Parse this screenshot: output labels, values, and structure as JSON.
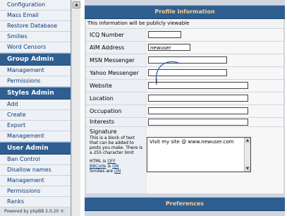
{
  "sidebar": {
    "top_items": [
      "Configuration",
      "Mass Email",
      "Restore Database",
      "Smilies",
      "Word Censors"
    ],
    "group_admin": {
      "title": "Group Admin",
      "items": [
        "Management",
        "Permissions"
      ]
    },
    "styles_admin": {
      "title": "Styles Admin",
      "items": [
        "Add",
        "Create",
        "Export",
        "Management"
      ]
    },
    "user_admin": {
      "title": "User Admin",
      "items": [
        "Ban Control",
        "Disallow names",
        "Management",
        "Permissions",
        "Ranks"
      ]
    },
    "powered_by": "Powered by phpBB 2.0.20 ©"
  },
  "profile": {
    "header": "Profile Information",
    "notice": "This information will be publicly viewable",
    "fields": [
      {
        "label": "ICQ Number",
        "value": ""
      },
      {
        "label": "AIM Address",
        "value": "newuser"
      },
      {
        "label": "MSN Messenger",
        "value": ""
      },
      {
        "label": "Yahoo Messenger",
        "value": ""
      },
      {
        "label": "Website",
        "value": ""
      },
      {
        "label": "Location",
        "value": ""
      },
      {
        "label": "Occupation",
        "value": ""
      },
      {
        "label": "Interests",
        "value": ""
      }
    ],
    "signature": {
      "label": "Signature",
      "description": "This is a block of text that can be added to posts you make. There is a 255 character limit",
      "html_prefix": "HTML is ",
      "html_state": "OFF",
      "bbcode_label": "BBCode",
      "bbcode_mid": " is ",
      "bbcode_state": "ON",
      "smilies_prefix": "Smilies are ",
      "smilies_state": "ON",
      "value": "Visit my site @ www.newuser.com"
    }
  },
  "preferences": {
    "header": "Preferences"
  },
  "colors": {
    "header_bg": "#2f5e91",
    "header_text": "#f6d28a",
    "link": "#0b3a78"
  }
}
